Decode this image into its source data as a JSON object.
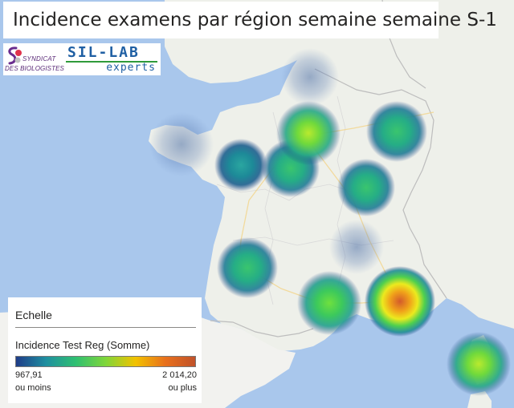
{
  "title": "Incidence examens par région semaine semaine S-1",
  "logos": {
    "syndicat_line1": "SYNDICAT",
    "syndicat_line2": "DES BIOLOGISTES",
    "sillab_word": "SIL-LAB",
    "sillab_sub": "experts"
  },
  "legend": {
    "heading": "Echelle",
    "field": "Incidence Test Reg (Somme)",
    "min_value": "967,91",
    "min_label": "ou moins",
    "max_value": "2 014,20",
    "max_label": "ou plus",
    "ramp_colors": [
      "#1f3c88",
      "#1f8fa0",
      "#2fbf71",
      "#7fd63a",
      "#f2c200",
      "#e8701d",
      "#c0522a"
    ]
  },
  "map": {
    "colors": {
      "sea": "#a9c7ec",
      "land": "#eef0ea",
      "land_dim": "#f2f2ef",
      "border": "#b7b7b7",
      "road": "#f3d58a"
    },
    "hotspots": [
      {
        "region": "Bretagne",
        "level": 0.05,
        "faint": true
      },
      {
        "region": "Pays de la Loire",
        "level": 0.12,
        "faint": false
      },
      {
        "region": "Centre-Val de Loire",
        "level": 0.28,
        "faint": false
      },
      {
        "region": "Île-de-France",
        "level": 0.45,
        "faint": false
      },
      {
        "region": "Grand Est",
        "level": 0.25,
        "faint": false
      },
      {
        "region": "Bourgogne-Franche-Comté",
        "level": 0.25,
        "faint": false
      },
      {
        "region": "Hauts-de-France",
        "level": 0.05,
        "faint": true
      },
      {
        "region": "Auvergne-Rhône-Alpes",
        "level": 0.05,
        "faint": true
      },
      {
        "region": "Nouvelle-Aquitaine",
        "level": 0.3,
        "faint": false
      },
      {
        "region": "Occitanie",
        "level": 0.32,
        "faint": false
      },
      {
        "region": "Provence-Alpes-Côte d'Azur",
        "level": 0.9,
        "faint": false
      },
      {
        "region": "Corse",
        "level": 0.55,
        "faint": false
      }
    ]
  }
}
